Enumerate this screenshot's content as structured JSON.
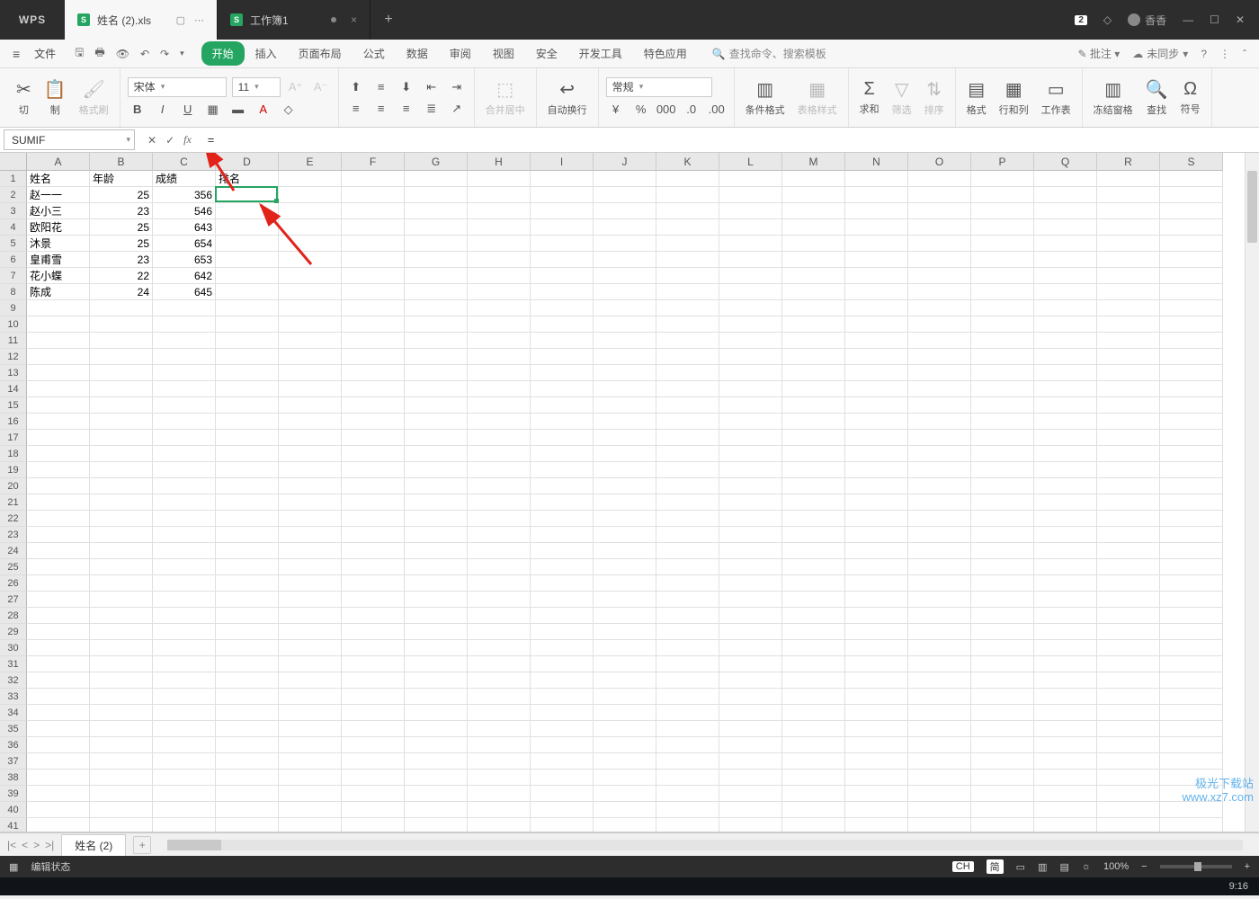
{
  "app": {
    "name": "WPS"
  },
  "tabs": [
    {
      "label": "姓名 (2).xls",
      "active": true
    },
    {
      "label": "工作簿1",
      "active": false
    }
  ],
  "titlebar": {
    "badge": "2",
    "user": "香香"
  },
  "menu": {
    "file": "文件",
    "items": [
      "开始",
      "插入",
      "页面布局",
      "公式",
      "数据",
      "审阅",
      "视图",
      "安全",
      "开发工具",
      "特色应用"
    ],
    "search_placeholder": "查找命令、搜索模板",
    "annotate": "批注",
    "sync": "未同步"
  },
  "ribbon": {
    "clip_cut": "切",
    "clip_copy": "制",
    "format_painter": "格式刷",
    "font_name": "宋体",
    "font_size": "11",
    "merge": "合并居中",
    "wrap": "自动换行",
    "numfmt": "常规",
    "cond_fmt": "条件格式",
    "table_style": "表格样式",
    "sum": "求和",
    "filter": "筛选",
    "sort": "排序",
    "format": "格式",
    "rowcol": "行和列",
    "worksheet": "工作表",
    "freeze": "冻结窗格",
    "find": "查找",
    "symbol": "符号"
  },
  "namebox": "SUMIF",
  "formula": "=",
  "columns": [
    "A",
    "B",
    "C",
    "D",
    "E",
    "F",
    "G",
    "H",
    "I",
    "J",
    "K",
    "L",
    "M",
    "N",
    "O",
    "P",
    "Q",
    "R",
    "S"
  ],
  "row_count": 41,
  "headers": {
    "A": "姓名",
    "B": "年龄",
    "C": "成绩",
    "D": "排名"
  },
  "data_rows": [
    {
      "A": "赵一一",
      "B": 25,
      "C": 356
    },
    {
      "A": "赵小三",
      "B": 23,
      "C": 546
    },
    {
      "A": "欧阳花",
      "B": 25,
      "C": 643
    },
    {
      "A": "沐景",
      "B": 25,
      "C": 654
    },
    {
      "A": "皇甫雪",
      "B": 23,
      "C": 653
    },
    {
      "A": "花小蝶",
      "B": 22,
      "C": 642
    },
    {
      "A": "陈成",
      "B": 24,
      "C": 645
    }
  ],
  "active_cell": {
    "col": "D",
    "row": 2,
    "display": "="
  },
  "sheet": {
    "name": "姓名 (2)"
  },
  "status": {
    "mode": "编辑状态",
    "zoom": "100%",
    "ime_lang": "CH",
    "ime_mode": "简"
  },
  "watermark": {
    "l1": "极光下载站",
    "l2": "www.xz7.com"
  },
  "clock": "9:16"
}
